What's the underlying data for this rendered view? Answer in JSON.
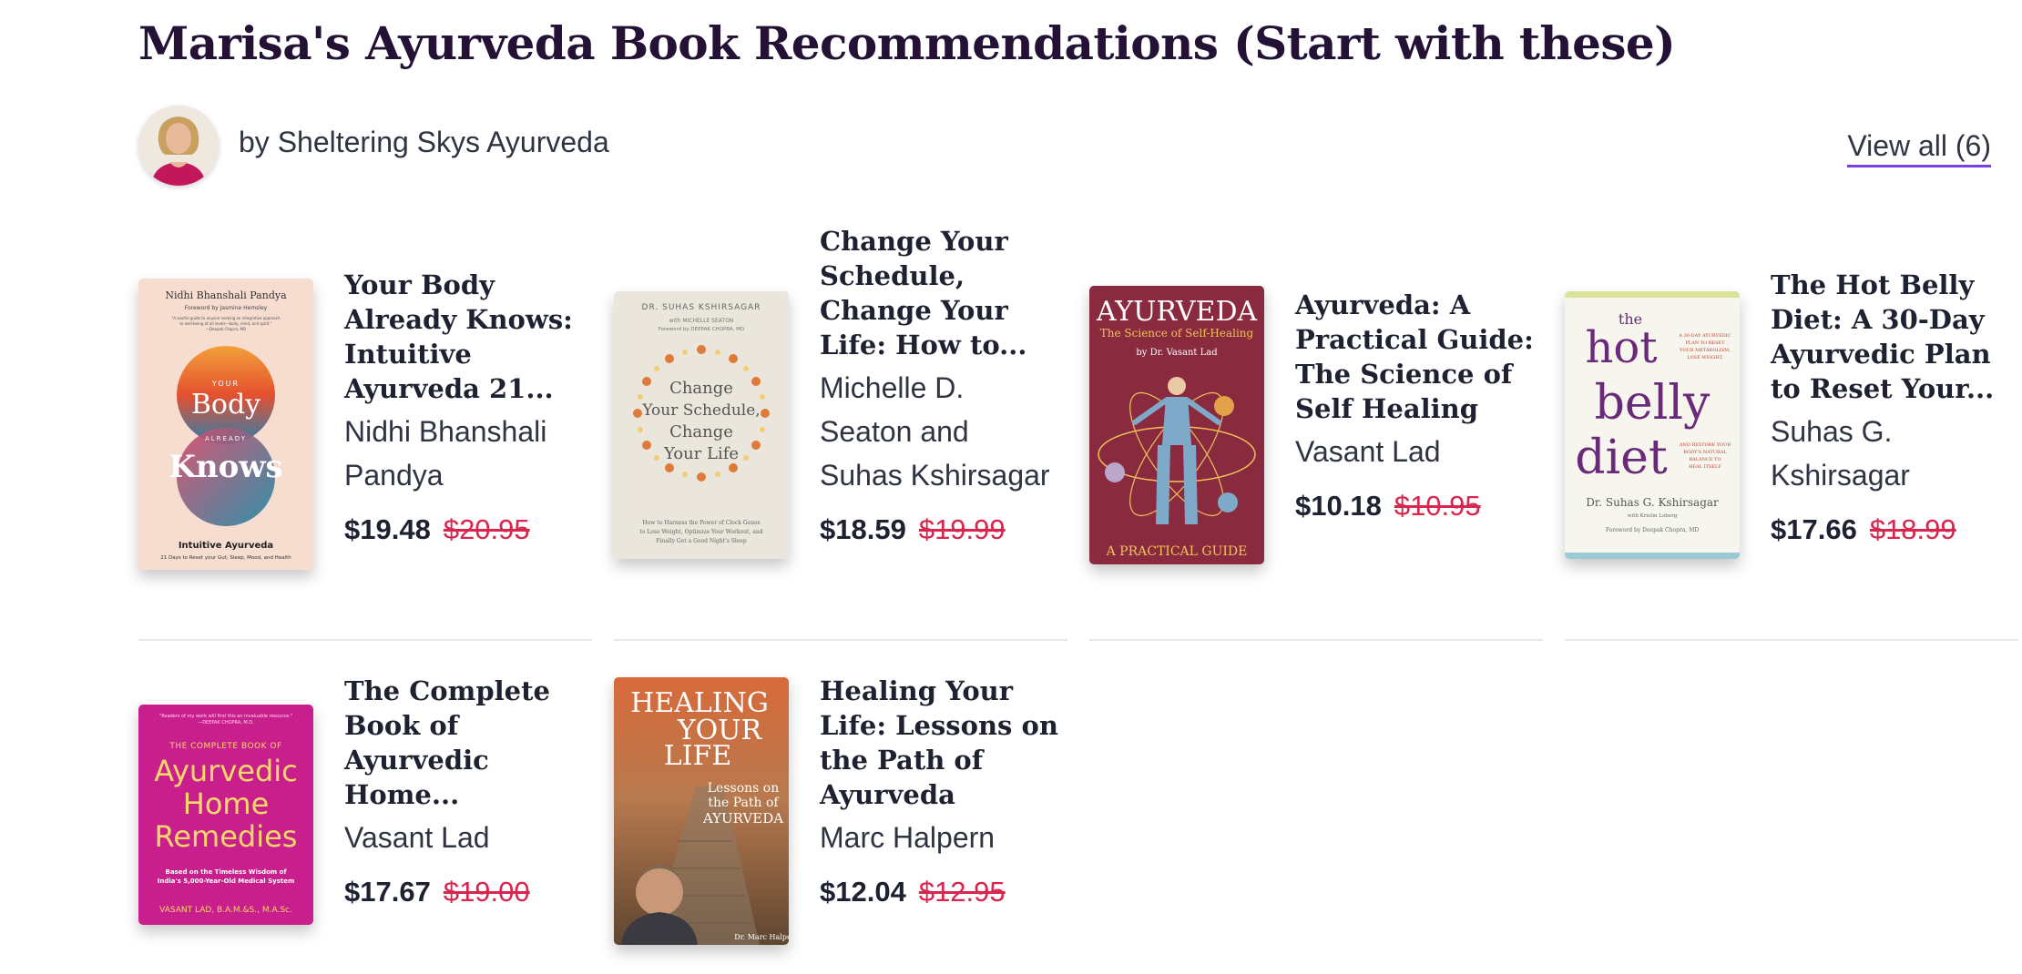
{
  "header": {
    "title": "Marisa's Ayurveda Book Recommendations (Start with these)",
    "byline": "by Sheltering Skys Ayurveda",
    "view_all": "View all (6)"
  },
  "colors": {
    "accent": "#7a3fe4",
    "sale_red": "#d8264f",
    "title": "#241236"
  },
  "books": [
    {
      "title": "Your Body Already Knows: Intuitive Ayurveda 21...",
      "author": "Nidhi Bhanshali Pandya",
      "price": "$19.48",
      "original_price": "$20.95",
      "cover": {
        "author": "Nidhi Bhanshali Pandya",
        "foreword": "Foreword by Jasmine Hemsley",
        "blurb1": "\"A soulful guide to anyone seeking an integrative approach",
        "blurb2": "to well-being at all levels—body, mind, and spirit.\"",
        "blurb_by": "—Deepak Chopra, MD",
        "w1": "YOUR",
        "w2": "Body",
        "w3": "ALREADY",
        "w4": "Knows",
        "sub1": "Intuitive Ayurveda",
        "sub2": "21 Days to Reset your Gut, Sleep, Mood, and Health"
      }
    },
    {
      "title": "Change Your Schedule, Change Your Life: How to...",
      "author": "Michelle D. Seaton and Suhas Kshirsagar",
      "price": "$18.59",
      "original_price": "$19.99",
      "cover": {
        "author": "DR. SUHAS KSHIRSAGAR",
        "with": "with MICHELLE SEATON",
        "foreword": "Foreword by DEEPAK CHOPRA, MD",
        "t1": "Change",
        "t2": "Your Schedule,",
        "t3": "Change",
        "t4": "Your Life",
        "sub1": "How to Harness the Power of Clock Genes",
        "sub2": "to Lose Weight, Optimize Your Workout, and",
        "sub3": "Finally Get a Good Night's Sleep"
      }
    },
    {
      "title": "Ayurveda: A Practical Guide: The Science of Self Healing",
      "author": "Vasant Lad",
      "price": "$10.18",
      "original_price": "$10.95",
      "cover": {
        "t1": "AYURVEDA",
        "t2": "The Science of Self-Healing",
        "author": "by Dr. Vasant Lad",
        "bottom": "A PRACTICAL GUIDE"
      }
    },
    {
      "title": "The Hot Belly Diet: A 30-Day Ayurvedic Plan to Reset Your...",
      "author": "Suhas G. Kshirsagar",
      "price": "$17.66",
      "original_price": "$18.99",
      "cover": {
        "the": "the",
        "hot": "hot",
        "belly": "belly",
        "diet": "diet",
        "r1": "A 30-DAY AYURVEDIC",
        "r2": "PLAN TO RESET",
        "r3": "YOUR METABOLISM,",
        "r4": "LOSE WEIGHT,",
        "r5": "AND RESTORE YOUR",
        "r6": "BODY'S NATURAL",
        "r7": "BALANCE TO",
        "r8": "HEAL ITSELF",
        "author": "Dr. Suhas G. Kshirsagar",
        "with": "with Kristin Loberg",
        "foreword": "Foreword by Deepak Chopra, MD"
      }
    },
    {
      "title": "The Complete Book of Ayurvedic Home...",
      "author": "Vasant Lad",
      "price": "$17.67",
      "original_price": "$19.00",
      "cover": {
        "quote1": "\"Readers of my work will find this an invaluable resource.\"",
        "quote2": "—DEEPAK CHOPRA, M.D.",
        "top": "THE COMPLETE BOOK OF",
        "t1": "Ayurvedic",
        "t2": "Home",
        "t3": "Remedies",
        "sub1": "Based on the Timeless Wisdom of",
        "sub2": "India's 5,000-Year-Old Medical System",
        "author": "VASANT LAD, B.A.M.&S., M.A.Sc."
      }
    },
    {
      "title": "Healing Your Life: Lessons on the Path of Ayurveda",
      "author": "Marc Halpern",
      "price": "$12.04",
      "original_price": "$12.95",
      "cover": {
        "t1": "HEALING",
        "t2": "YOUR",
        "t3": "LIFE",
        "s1": "Lessons on",
        "s2": "the Path of",
        "s3": "AYURVEDA",
        "author": "Dr. Marc Halpern"
      }
    }
  ]
}
